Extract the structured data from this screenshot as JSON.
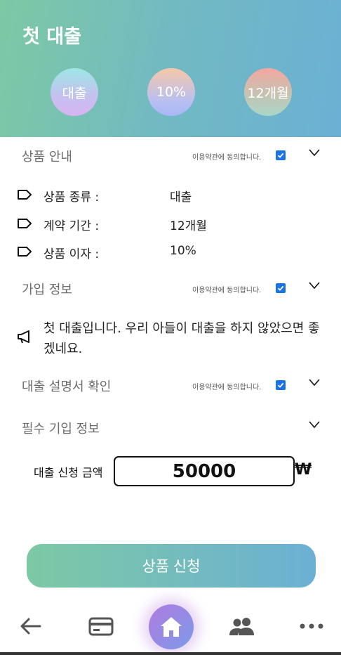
{
  "header": {
    "title": "첫 대출",
    "badges": [
      "대출",
      "10%",
      "12개월"
    ]
  },
  "sections": [
    {
      "title": "상품 안내",
      "terms": "이용약관에 동의합니다.",
      "checked": true
    },
    {
      "title": "가입 정보",
      "terms": "이용약관에 동의합니다.",
      "checked": true
    },
    {
      "title": "대출 설명서 확인",
      "terms": "이용약관에 동의합니다.",
      "checked": true
    },
    {
      "title": "필수 기입 정보"
    }
  ],
  "product_info": [
    {
      "label": "상품 종류 :",
      "value": "대출"
    },
    {
      "label": "계약 기간 :",
      "value": "12개월"
    },
    {
      "label": "상품 이자 :",
      "value": "10%"
    }
  ],
  "notice": "첫 대출입니다. 우리 아들이 대출을 하지 않았으면 좋겠네요.",
  "amount": {
    "label": "대출 신청 금액",
    "value": "50000",
    "currency": "₩"
  },
  "apply_button": "상품 신청",
  "icons": {
    "back": "arrow-left-icon",
    "card": "credit-card-icon",
    "home": "home-icon",
    "people": "users-icon",
    "more": "more-icon"
  },
  "colors": {
    "accent_start": "#7dc9a4",
    "accent_end": "#6bb0d4",
    "checkbox": "#1a73e8"
  }
}
